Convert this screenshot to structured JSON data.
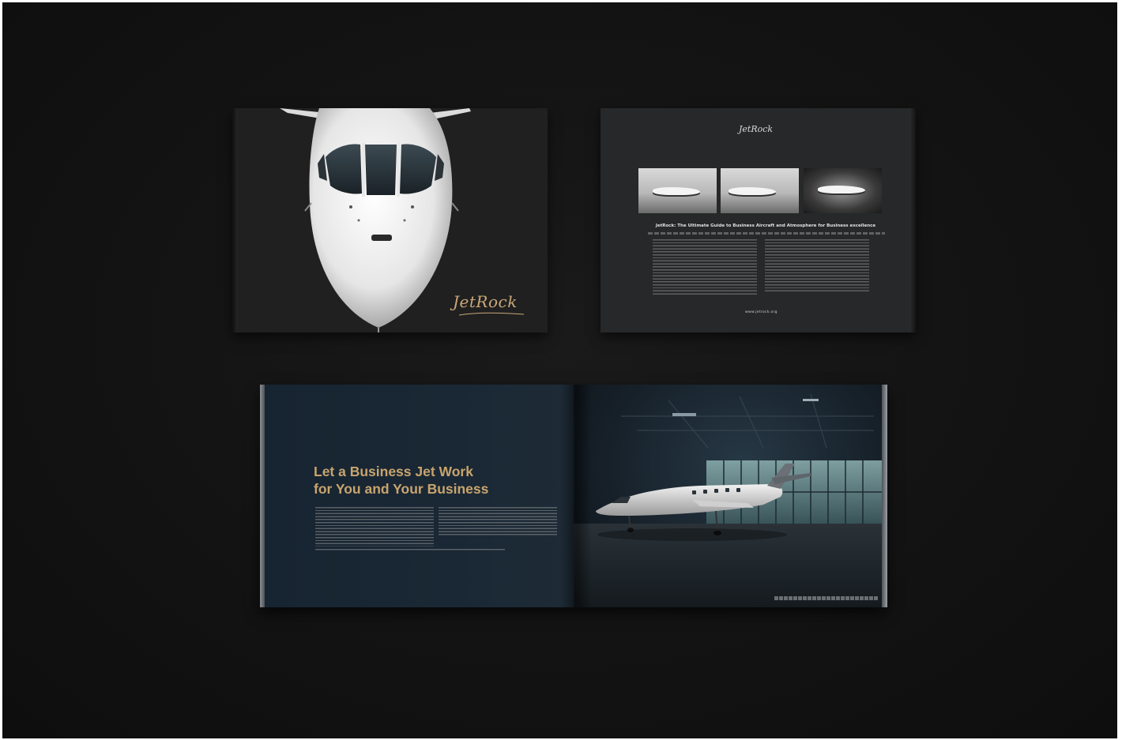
{
  "scene": {
    "description_hidden": "",
    "background_color": "#131313"
  },
  "front_cover": {
    "logo_text": "JetRock",
    "logo_color": "#c9a878"
  },
  "back_cover": {
    "logo_text": "JetRock",
    "heading": "JetRock: The Ultimate Guide to Business Aircraft and Atmosphere for Business excellence",
    "website": "www.jetrock.org"
  },
  "spread": {
    "headline_line_1": "Let a Business Jet Work",
    "headline_line_2": "for You and Your Business",
    "headline_color": "#c8a46e"
  }
}
